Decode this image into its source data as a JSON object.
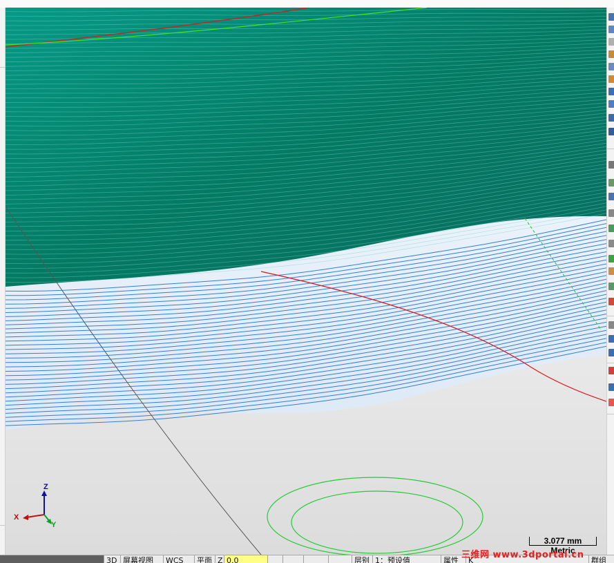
{
  "viewport": {
    "axis_triad": {
      "z_label": "Z",
      "x_label": "X",
      "y_label": "Y"
    },
    "scale_bar": {
      "value": "3.077 mm",
      "unit": "Metric"
    },
    "colors": {
      "surface_green": "#00836e",
      "toolpath_blue": "#2f7fd6",
      "circle_green": "#22cc33",
      "red_curve": "#d42020",
      "background": "#eeeeee"
    }
  },
  "statusbar": {
    "items": [
      {
        "name": "view-3d",
        "label": "3D"
      },
      {
        "name": "screen-view",
        "label": "屏幕视图"
      },
      {
        "name": "wcs",
        "label": "WCS"
      },
      {
        "name": "plane",
        "label": "平面"
      },
      {
        "name": "z-label",
        "label": "Z"
      },
      {
        "name": "z-value",
        "label": "0.0"
      },
      {
        "name": "shading-1",
        "label": ""
      },
      {
        "name": "shading-2",
        "label": ""
      },
      {
        "name": "shading-3",
        "label": ""
      },
      {
        "name": "layer",
        "label": "层别"
      },
      {
        "name": "layer-value",
        "label": "1：预设值"
      },
      {
        "name": "attributes",
        "label": "属性"
      },
      {
        "name": "k",
        "label": "K"
      },
      {
        "name": "group",
        "label": "群组"
      }
    ],
    "watermark": "三维网 www.3dportal.cn"
  }
}
